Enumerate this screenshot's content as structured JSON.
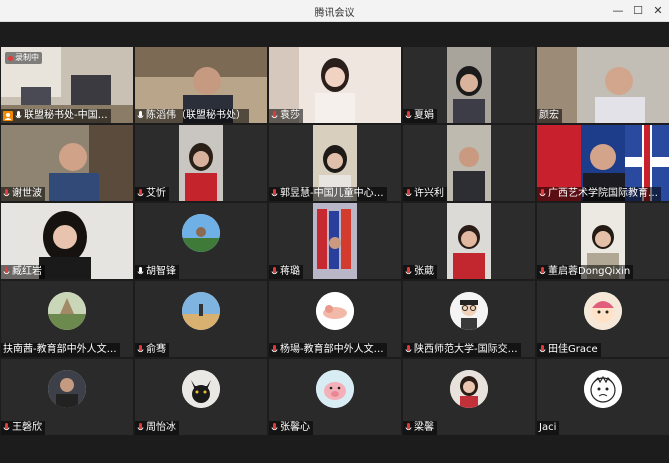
{
  "window": {
    "title": "腾讯会议",
    "min_symbol": "—",
    "max_symbol": "☐",
    "close_symbol": "✕"
  },
  "recording_label": "录制中",
  "participants": [
    {
      "name": "联盟秘书处-中国…",
      "type": "video",
      "icon": "host-icon"
    },
    {
      "name": "陈滔伟（联盟秘书处）",
      "type": "video"
    },
    {
      "name": "袁莎",
      "type": "video"
    },
    {
      "name": "夏娟",
      "type": "video"
    },
    {
      "name": "颜宏",
      "type": "video"
    },
    {
      "name": "谢世波",
      "type": "video"
    },
    {
      "name": "艾忻",
      "type": "video"
    },
    {
      "name": "郭昱慧-中国儿童中心…",
      "type": "video"
    },
    {
      "name": "许兴利",
      "type": "video"
    },
    {
      "name": "广西艺术学院国际教育…",
      "type": "video"
    },
    {
      "name": "臧红岩",
      "type": "video"
    },
    {
      "name": "胡智锋",
      "type": "avatar"
    },
    {
      "name": "蒋璐",
      "type": "video"
    },
    {
      "name": "张葳",
      "type": "video"
    },
    {
      "name": "董启蓉DongQixin",
      "type": "video"
    },
    {
      "name": "扶南茜-教育部中外人文…",
      "type": "avatar"
    },
    {
      "name": "俞骞",
      "type": "avatar"
    },
    {
      "name": "杨瑒-教育部中外人文…",
      "type": "avatar"
    },
    {
      "name": "陕西师范大学-国际交…",
      "type": "avatar"
    },
    {
      "name": "田佳Grace",
      "type": "avatar"
    },
    {
      "name": "王磬欣",
      "type": "avatar"
    },
    {
      "name": "周怡冰",
      "type": "avatar"
    },
    {
      "name": "张馨心",
      "type": "avatar"
    },
    {
      "name": "梁馨",
      "type": "avatar"
    },
    {
      "name": "Jaci",
      "type": "avatar",
      "no_mic": true
    }
  ],
  "colors": {
    "active_speaker": "#1fb14d",
    "mic_icon": "#e23a3a",
    "background": "#1c1c1c"
  }
}
